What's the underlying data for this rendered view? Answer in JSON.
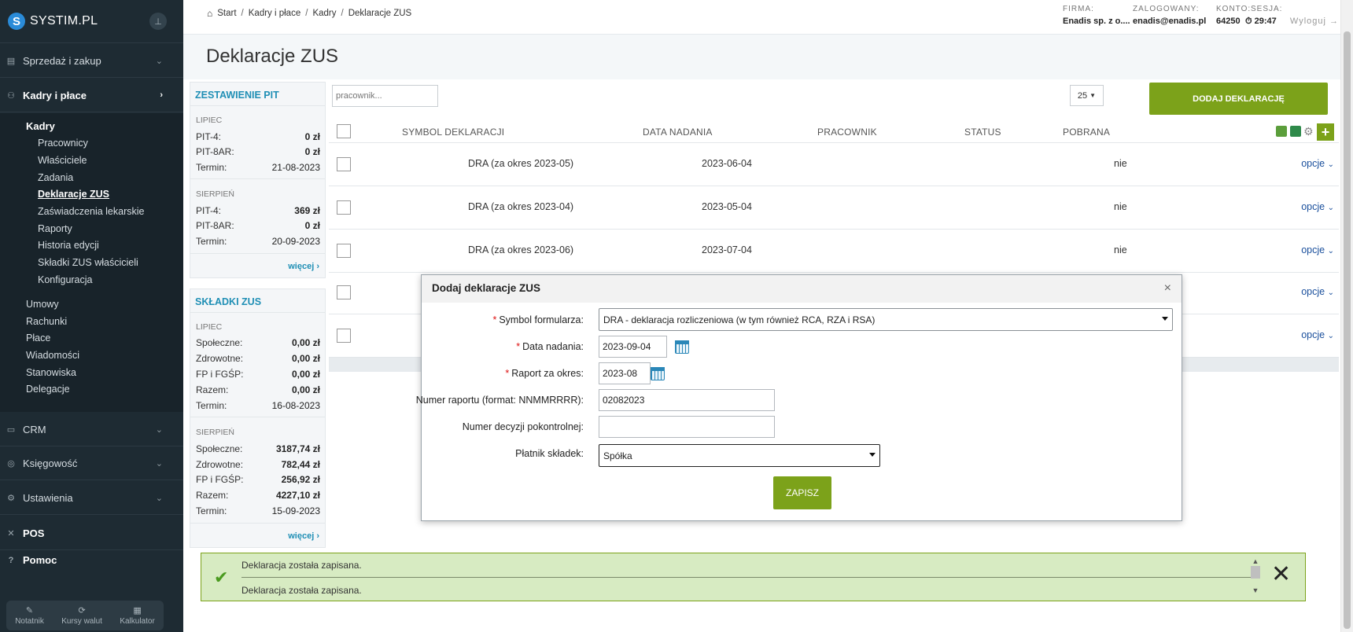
{
  "app": {
    "logo_letter": "S",
    "logo_text": "SYSTIM.PL"
  },
  "sidebar": {
    "sections": [
      {
        "label": "Sprzedaż i zakup",
        "icon": "cart-icon"
      },
      {
        "label": "Kadry i płace",
        "icon": "people-icon"
      },
      {
        "label": "CRM",
        "icon": "crm-icon"
      },
      {
        "label": "Księgowość",
        "icon": "coins-icon"
      },
      {
        "label": "Ustawienia",
        "icon": "gear-icon"
      },
      {
        "label": "POS",
        "icon": "pos-icon"
      },
      {
        "label": "Pomoc",
        "icon": "help-icon"
      }
    ],
    "submenu_head": "Kadry",
    "submenu_items": [
      "Pracownicy",
      "Właściciele",
      "Zadania",
      "Deklaracje ZUS",
      "Zaświadczenia lekarskie",
      "Raporty",
      "Historia edycji",
      "Składki ZUS właścicieli",
      "Konfiguracja"
    ],
    "other_items": [
      "Umowy",
      "Rachunki",
      "Płace",
      "Wiadomości",
      "Stanowiska",
      "Delegacje"
    ],
    "tools": [
      {
        "label": "Notatnik",
        "icon": "notepad-icon"
      },
      {
        "label": "Kursy walut",
        "icon": "currency-icon"
      },
      {
        "label": "Kalkulator",
        "icon": "calculator-icon"
      }
    ]
  },
  "header": {
    "breadcrumb": [
      "Start",
      "Kadry i płace",
      "Kadry",
      "Deklaracje ZUS"
    ],
    "firma_label": "FIRMA:",
    "firma_value": "Enadis sp. z o....",
    "zalogowany_label": "ZALOGOWANY:",
    "zalogowany_value": "enadis@enadis.pl",
    "konto_label": "KONTO:",
    "konto_value": "64250",
    "sesja_label": "SESJA:",
    "sesja_value": "29:47",
    "logout": "Wyloguj →"
  },
  "page_title": "Deklaracje ZUS",
  "pit_panel": {
    "title": "ZESTAWIENIE PIT",
    "months": [
      {
        "name": "LIPIEC",
        "rows": [
          {
            "k": "PIT-4:",
            "v": "0 zł"
          },
          {
            "k": "PIT-8AR:",
            "v": "0 zł"
          },
          {
            "k": "Termin:",
            "v": "21-08-2023"
          }
        ]
      },
      {
        "name": "SIERPIEŃ",
        "rows": [
          {
            "k": "PIT-4:",
            "v": "369 zł"
          },
          {
            "k": "PIT-8AR:",
            "v": "0 zł"
          },
          {
            "k": "Termin:",
            "v": "20-09-2023"
          }
        ]
      }
    ],
    "more": "więcej"
  },
  "zus_panel": {
    "title": "SKŁADKI ZUS",
    "months": [
      {
        "name": "LIPIEC",
        "rows": [
          {
            "k": "Społeczne:",
            "v": "0,00 zł"
          },
          {
            "k": "Zdrowotne:",
            "v": "0,00 zł"
          },
          {
            "k": "FP i FGŚP:",
            "v": "0,00 zł"
          },
          {
            "k": "Razem:",
            "v": "0,00 zł"
          },
          {
            "k": "Termin:",
            "v": "16-08-2023"
          }
        ]
      },
      {
        "name": "SIERPIEŃ",
        "rows": [
          {
            "k": "Społeczne:",
            "v": "3187,74 zł"
          },
          {
            "k": "Zdrowotne:",
            "v": "782,44 zł"
          },
          {
            "k": "FP i FGŚP:",
            "v": "256,92 zł"
          },
          {
            "k": "Razem:",
            "v": "4227,10 zł"
          },
          {
            "k": "Termin:",
            "v": "15-09-2023"
          }
        ]
      }
    ],
    "more": "więcej"
  },
  "list": {
    "search_placeholder": "pracownik...",
    "page_size": "25",
    "add_button": "DODAJ DEKLARACJĘ",
    "columns": [
      "SYMBOL DEKLARACJI",
      "DATA NADANIA",
      "PRACOWNIK",
      "STATUS",
      "POBRANA"
    ],
    "rows": [
      {
        "symbol": "DRA (za okres 2023-05)",
        "date": "2023-06-04",
        "pobrana": "nie",
        "opcje": "opcje"
      },
      {
        "symbol": "DRA (za okres 2023-04)",
        "date": "2023-05-04",
        "pobrana": "nie",
        "opcje": "opcje"
      },
      {
        "symbol": "DRA (za okres 2023-06)",
        "date": "2023-07-04",
        "pobrana": "nie",
        "opcje": "opcje"
      },
      {
        "symbol": "",
        "date": "",
        "pobrana": "",
        "opcje": "opcje"
      },
      {
        "symbol": "",
        "date": "",
        "pobrana": "",
        "opcje": "opcje"
      }
    ]
  },
  "modal": {
    "title": "Dodaj deklaracje ZUS",
    "close": "×",
    "fields": {
      "symbol_label": "Symbol formularza:",
      "symbol_value": "DRA - deklaracja rozliczeniowa (w tym również RCA, RZA i RSA)",
      "data_label": "Data nadania:",
      "data_value": "2023-09-04",
      "raport_label": "Raport za okres:",
      "raport_value": "2023-08",
      "numer_label": "Numer raportu (format: NNMMRRRR):",
      "numer_value": "02082023",
      "decyzja_label": "Numer decyzji pokontrolnej:",
      "decyzja_value": "",
      "platnik_label": "Płatnik składek:",
      "platnik_value": "Spółka"
    },
    "save": "ZAPISZ"
  },
  "notification": {
    "messages": [
      "Deklaracja została zapisana.",
      "Deklaracja została zapisana."
    ]
  },
  "colors": {
    "accent_green": "#7ca21a",
    "sidebar_bg": "#1e2b33",
    "link_blue": "#1f8fb5"
  }
}
